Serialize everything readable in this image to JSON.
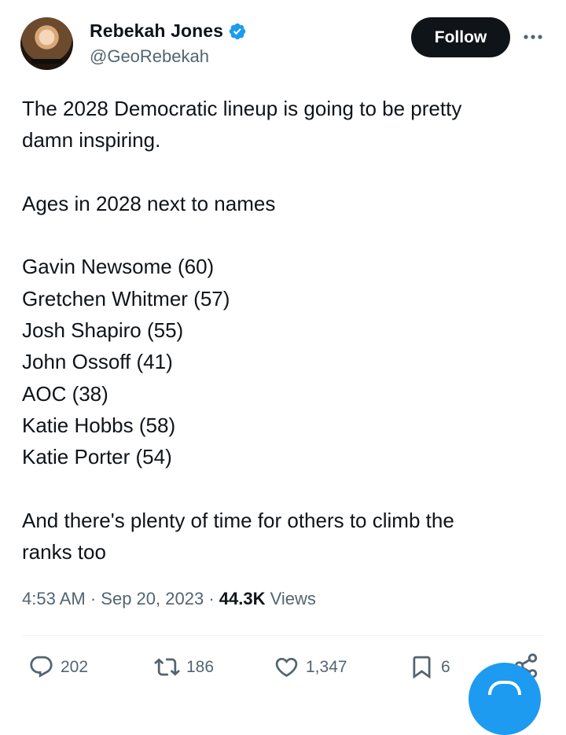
{
  "author": {
    "display_name": "Rebekah Jones",
    "handle": "@GeoRebekah",
    "verified": true,
    "verified_color": "#1d9bf0"
  },
  "header": {
    "follow_label": "Follow"
  },
  "tweet": {
    "lines": [
      "The 2028 Democratic lineup is going to be pretty",
      "damn inspiring.",
      "",
      "Ages in 2028 next to names",
      "",
      "Gavin Newsome (60)",
      "Gretchen Whitmer (57)",
      "Josh Shapiro (55)",
      "John Ossoff (41)",
      "AOC (38)",
      "Katie Hobbs (58)",
      "Katie Porter (54)",
      "",
      "And there's plenty of time for others to climb the",
      "ranks too"
    ]
  },
  "meta": {
    "time": "4:53 AM",
    "separator": "·",
    "date": "Sep 20, 2023",
    "views_count": "44.3K",
    "views_label": "Views"
  },
  "actions": {
    "replies": "202",
    "reposts": "186",
    "likes": "1,347",
    "bookmarks": "6"
  },
  "colors": {
    "text": "#0f1419",
    "secondary": "#536471",
    "accent": "#1d9bf0"
  },
  "icons": [
    "verified-badge-icon",
    "more-icon",
    "reply-icon",
    "repost-icon",
    "like-icon",
    "bookmark-icon",
    "share-icon",
    "compose-icon"
  ]
}
